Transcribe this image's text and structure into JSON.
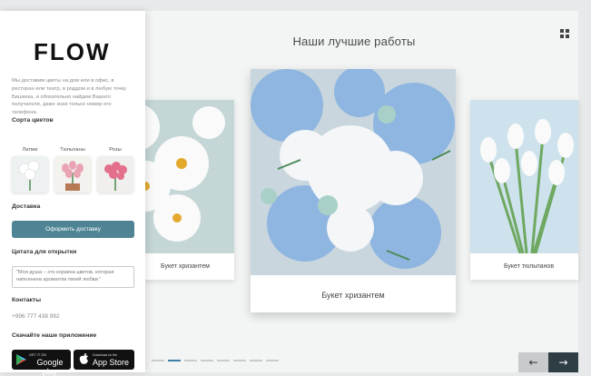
{
  "sidebar": {
    "logo": "FLOW",
    "about": "Мы доставим цветы на дом или в офис, в ресторан или театр, в роддом и в любую точку Бишкека, и обязательно найдем Вашего получателя, даже зная только номер его телефона.",
    "varieties_label": "Сорта цветов",
    "varieties": [
      {
        "name": "Лилии"
      },
      {
        "name": "Тюльпаны"
      },
      {
        "name": "Розы"
      }
    ],
    "delivery_label": "Доставка",
    "order_button": "Оформить доставку",
    "quote_label": "Цитата для открытки",
    "quote_text": "\"Моя душа – это корзина цветов, которая наполнена ароматом твоей любви.\"",
    "contacts_label": "Контакты",
    "phone": "+996 777 438 992",
    "download_label": "Скачайте наше приложение",
    "google_play_small": "Get it on",
    "google_play": "Google play",
    "app_store_small": "Download on the",
    "app_store": "App Store"
  },
  "main": {
    "title": "Наши лучшие работы",
    "cards": [
      {
        "caption": "Букет хризантем"
      },
      {
        "caption": "Букет хризантем"
      },
      {
        "caption": "Букет тюльпанов"
      }
    ],
    "pagination": {
      "total": 8,
      "active": 1
    },
    "prev_label": "←",
    "next_label": "→"
  },
  "colors": {
    "accent": "#4e8494",
    "pagination_active": "#3f7fa4",
    "next_button": "#2f3d44"
  }
}
